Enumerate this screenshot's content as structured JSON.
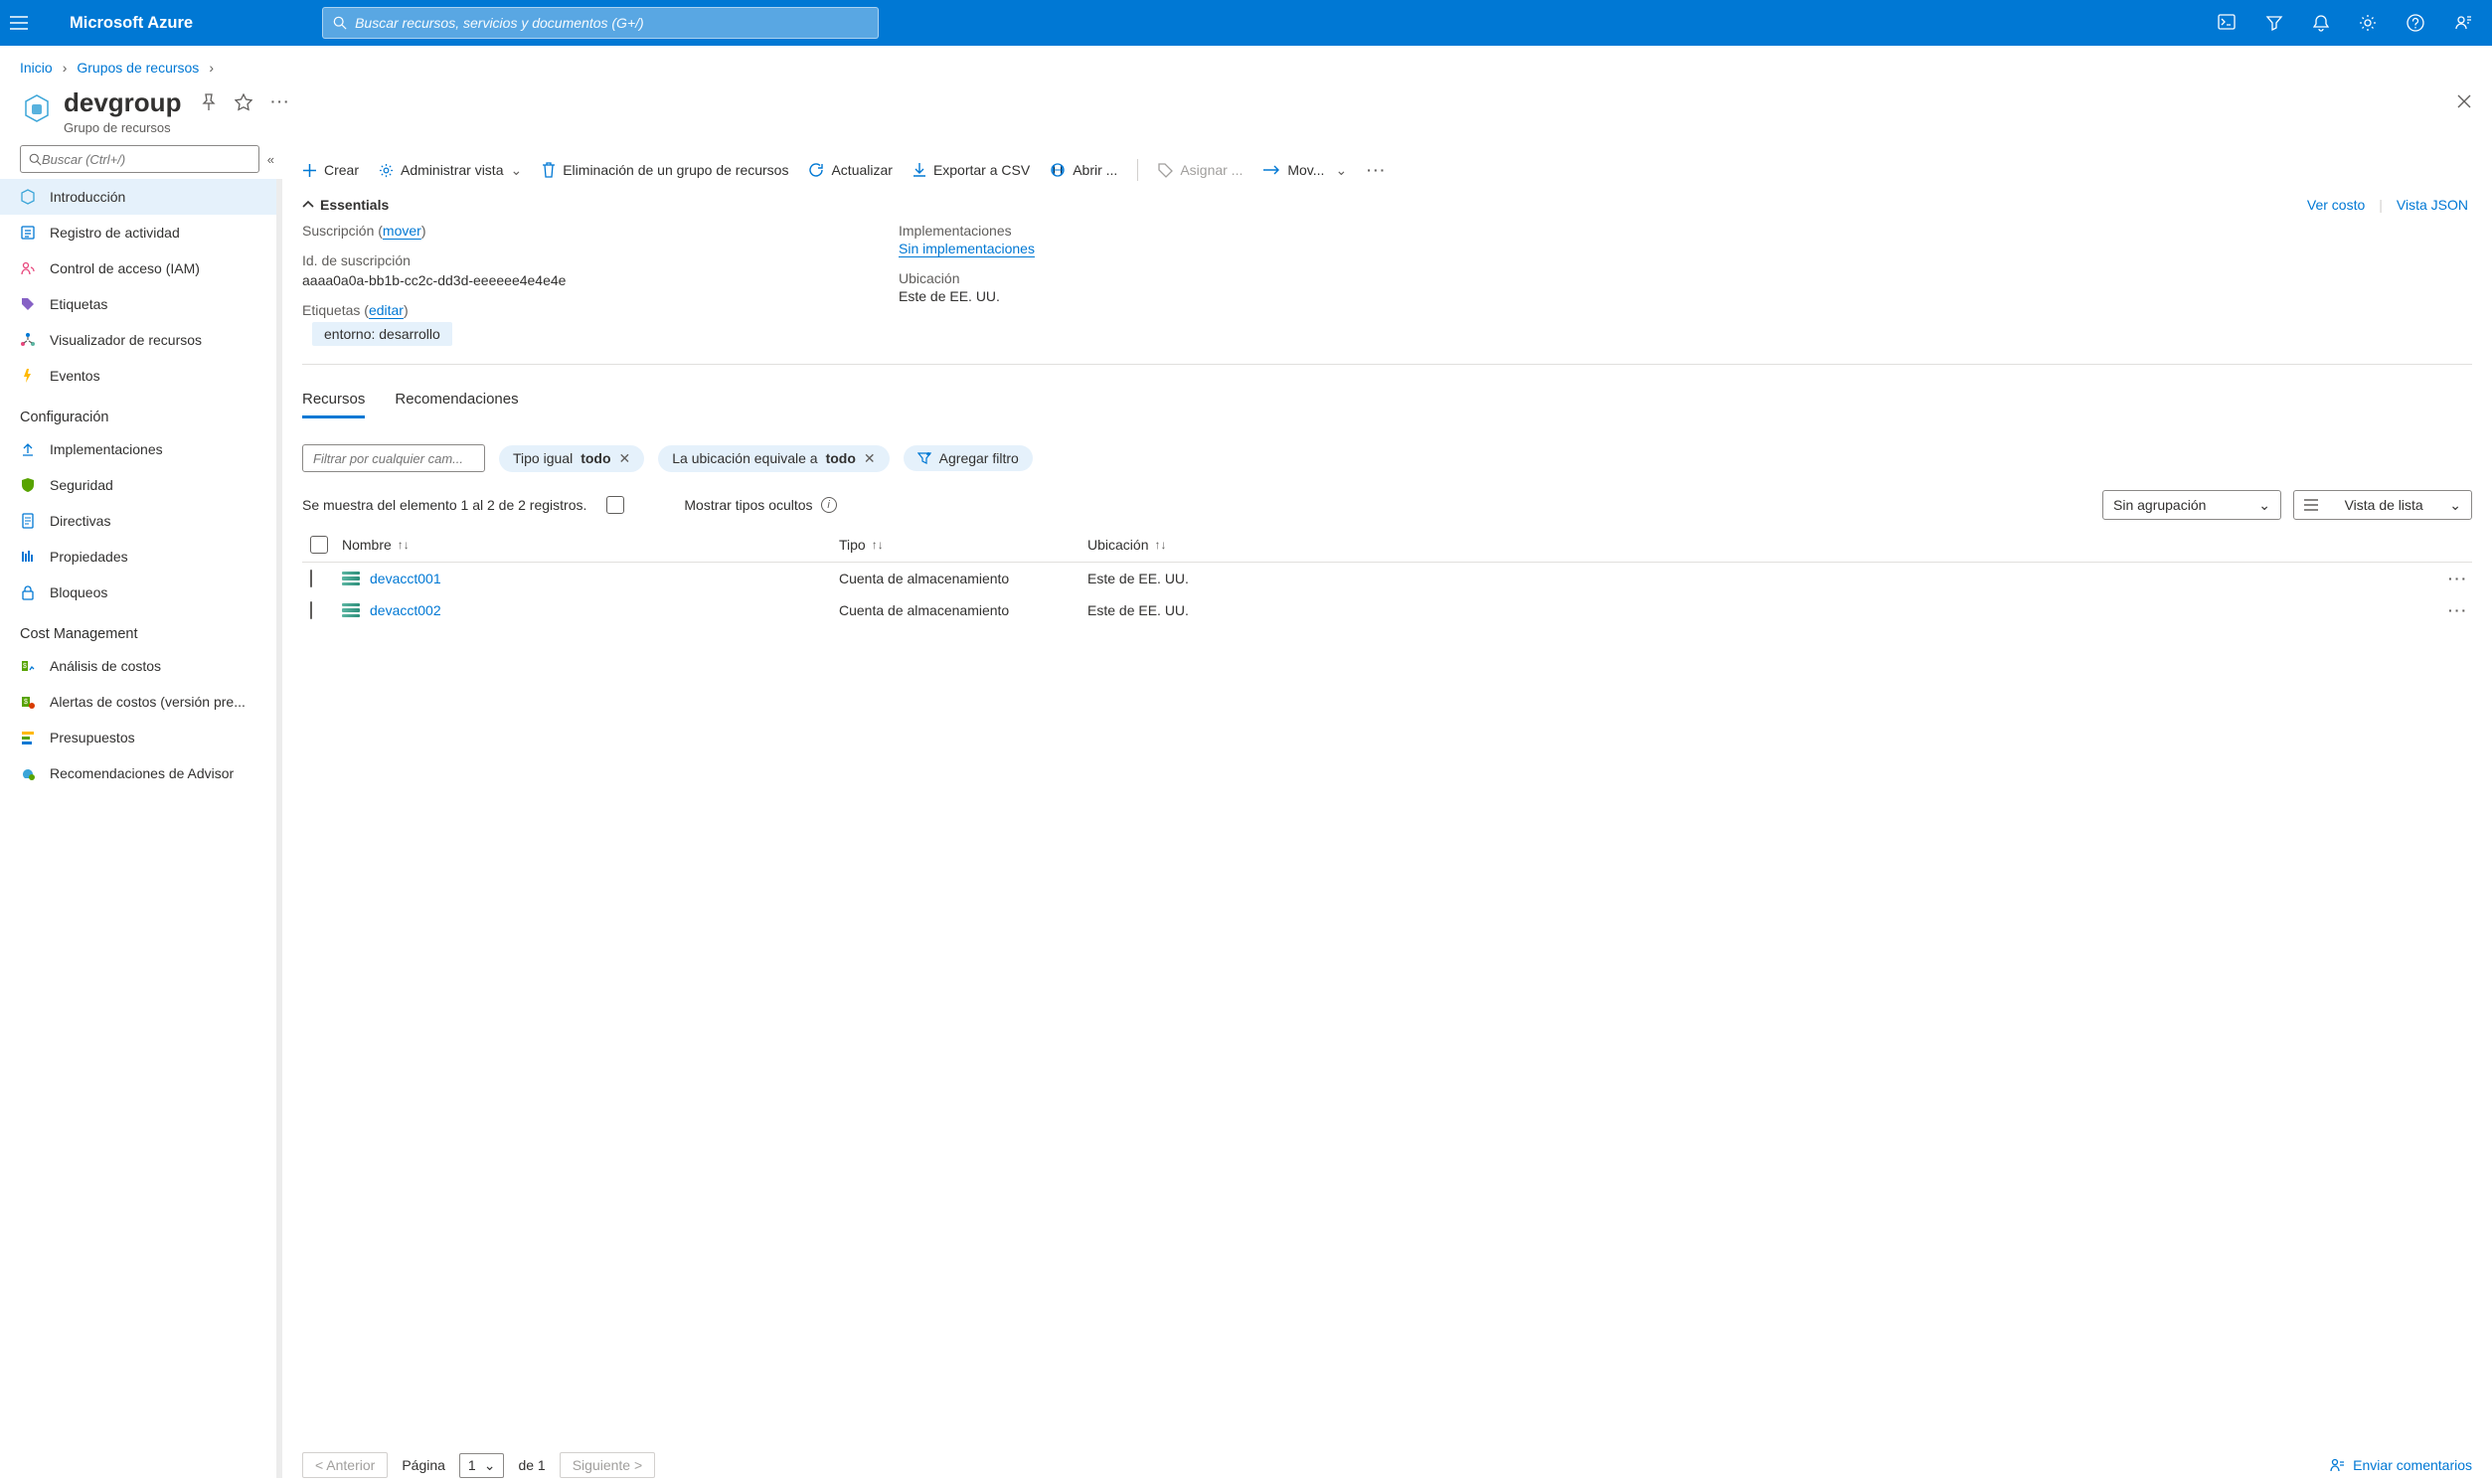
{
  "topbar": {
    "brand": "Microsoft Azure",
    "search_placeholder": "Buscar recursos, servicios y documentos (G+/)"
  },
  "breadcrumb": {
    "home": "Inicio",
    "groups": "Grupos de recursos"
  },
  "header": {
    "title": "devgroup",
    "subtitle": "Grupo de recursos"
  },
  "side_search_placeholder": "Buscar (Ctrl+/)",
  "sidebar": {
    "items_top": [
      "Introducción",
      "Registro de actividad",
      "Control de acceso (IAM)",
      "Etiquetas",
      "Visualizador de recursos",
      "Eventos"
    ],
    "section_config": "Configuración",
    "items_config": [
      "Implementaciones",
      "Seguridad",
      "Directivas",
      "Propiedades",
      "Bloqueos"
    ],
    "section_cost": "Cost Management",
    "items_cost": [
      "Análisis de costos",
      "Alertas de costos (versión pre...",
      "Presupuestos",
      "Recomendaciones de Advisor"
    ]
  },
  "toolbar": {
    "create": "Crear",
    "manage_view": "Administrar vista",
    "delete_rg": "Eliminación de un grupo de recursos",
    "refresh": "Actualizar",
    "export_csv": "Exportar a CSV",
    "open": "Abrir ...",
    "assign": "Asignar ...",
    "move": "Mov..."
  },
  "essentials": {
    "header": "Essentials",
    "view_cost": "Ver costo",
    "view_json": "Vista JSON",
    "subscription_label": "Suscripción (",
    "subscription_move": "mover",
    "subscription_close": ")",
    "sub_id_label": "Id. de suscripción",
    "sub_id_value": "aaaa0a0a-bb1b-cc2c-dd3d-eeeeee4e4e4e",
    "tags_label": "Etiquetas (",
    "tags_edit": "editar",
    "tags_close": ")",
    "tag_pill": "entorno: desarrollo",
    "deployments_label": "Implementaciones",
    "deployments_value": "Sin implementaciones",
    "location_label": "Ubicación",
    "location_value": "Este de EE. UU."
  },
  "tabs": {
    "resources": "Recursos",
    "recommendations": "Recomendaciones"
  },
  "filters": {
    "placeholder": "Filtrar por cualquier cam...",
    "type_prefix": "Tipo igual ",
    "type_value": "todo",
    "loc_prefix": "La ubicación equivale a ",
    "loc_value": "todo",
    "add_filter": "Agregar filtro"
  },
  "list_controls": {
    "summary": "Se muestra del elemento 1 al 2 de 2 registros.",
    "hidden_types": "Mostrar tipos ocultos",
    "grouping": "Sin agrupación",
    "view_mode": "Vista de lista"
  },
  "columns": {
    "name": "Nombre",
    "type": "Tipo",
    "location": "Ubicación"
  },
  "rows": [
    {
      "name": "devacct001",
      "type": "Cuenta de almacenamiento",
      "location": "Este de EE. UU."
    },
    {
      "name": "devacct002",
      "type": "Cuenta de almacenamiento",
      "location": "Este de EE. UU."
    }
  ],
  "pager": {
    "prev": "< Anterior",
    "page_label": "Página",
    "page_val": "1",
    "of_label": "de 1",
    "next": "Siguiente >",
    "feedback": "Enviar comentarios"
  }
}
